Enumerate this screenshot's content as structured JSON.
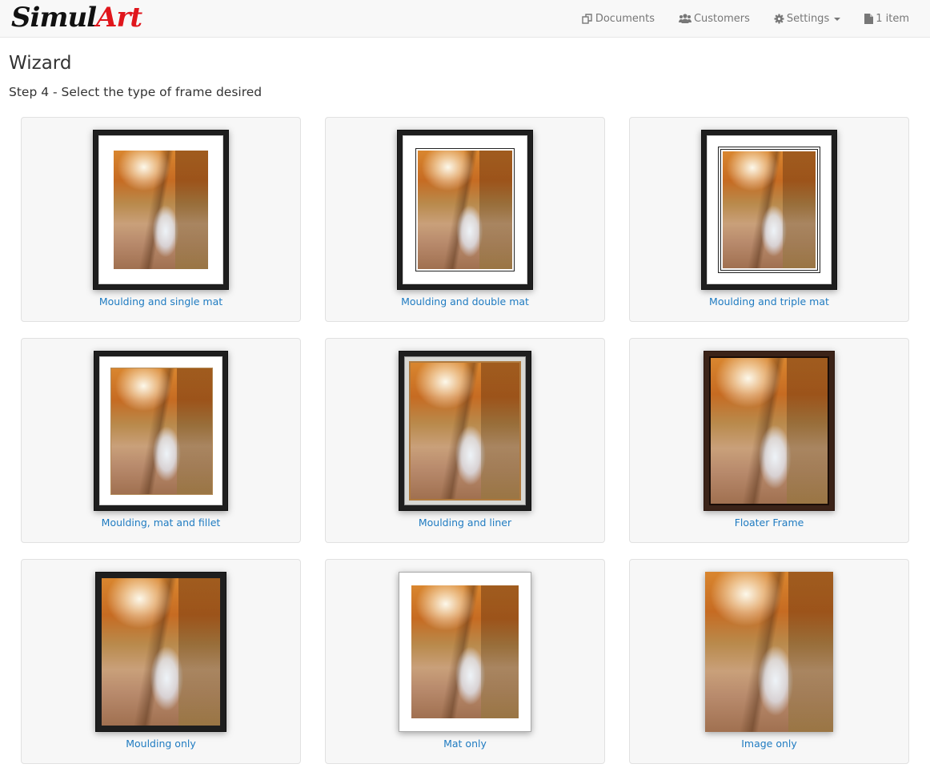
{
  "brand": {
    "part1": "Simul",
    "part2": "Art",
    "accent": "#e0161c"
  },
  "nav": {
    "items": [
      {
        "label": "Documents",
        "icon": "documents-icon"
      },
      {
        "label": "Customers",
        "icon": "users-icon"
      },
      {
        "label": "Settings",
        "icon": "gear-icon",
        "dropdown": true
      },
      {
        "label": "1 item",
        "icon": "file-icon"
      }
    ]
  },
  "page": {
    "title": "Wizard",
    "step": "Step 4 - Select the type of frame desired"
  },
  "frame_types": [
    {
      "label": "Moulding and single mat",
      "style": "single-mat"
    },
    {
      "label": "Moulding and double mat",
      "style": "double-mat"
    },
    {
      "label": "Moulding and triple mat",
      "style": "triple-mat"
    },
    {
      "label": "Moulding, mat and fillet",
      "style": "mat-fillet"
    },
    {
      "label": "Moulding and liner",
      "style": "liner"
    },
    {
      "label": "Floater Frame",
      "style": "floater"
    },
    {
      "label": "Moulding only",
      "style": "moulding-only"
    },
    {
      "label": "Mat only",
      "style": "mat-only"
    },
    {
      "label": "Image only",
      "style": "image-only"
    }
  ],
  "colors": {
    "link": "#1f7bc1",
    "card_bg": "#f7f7f7",
    "navbar_bg": "#f8f8f8"
  }
}
